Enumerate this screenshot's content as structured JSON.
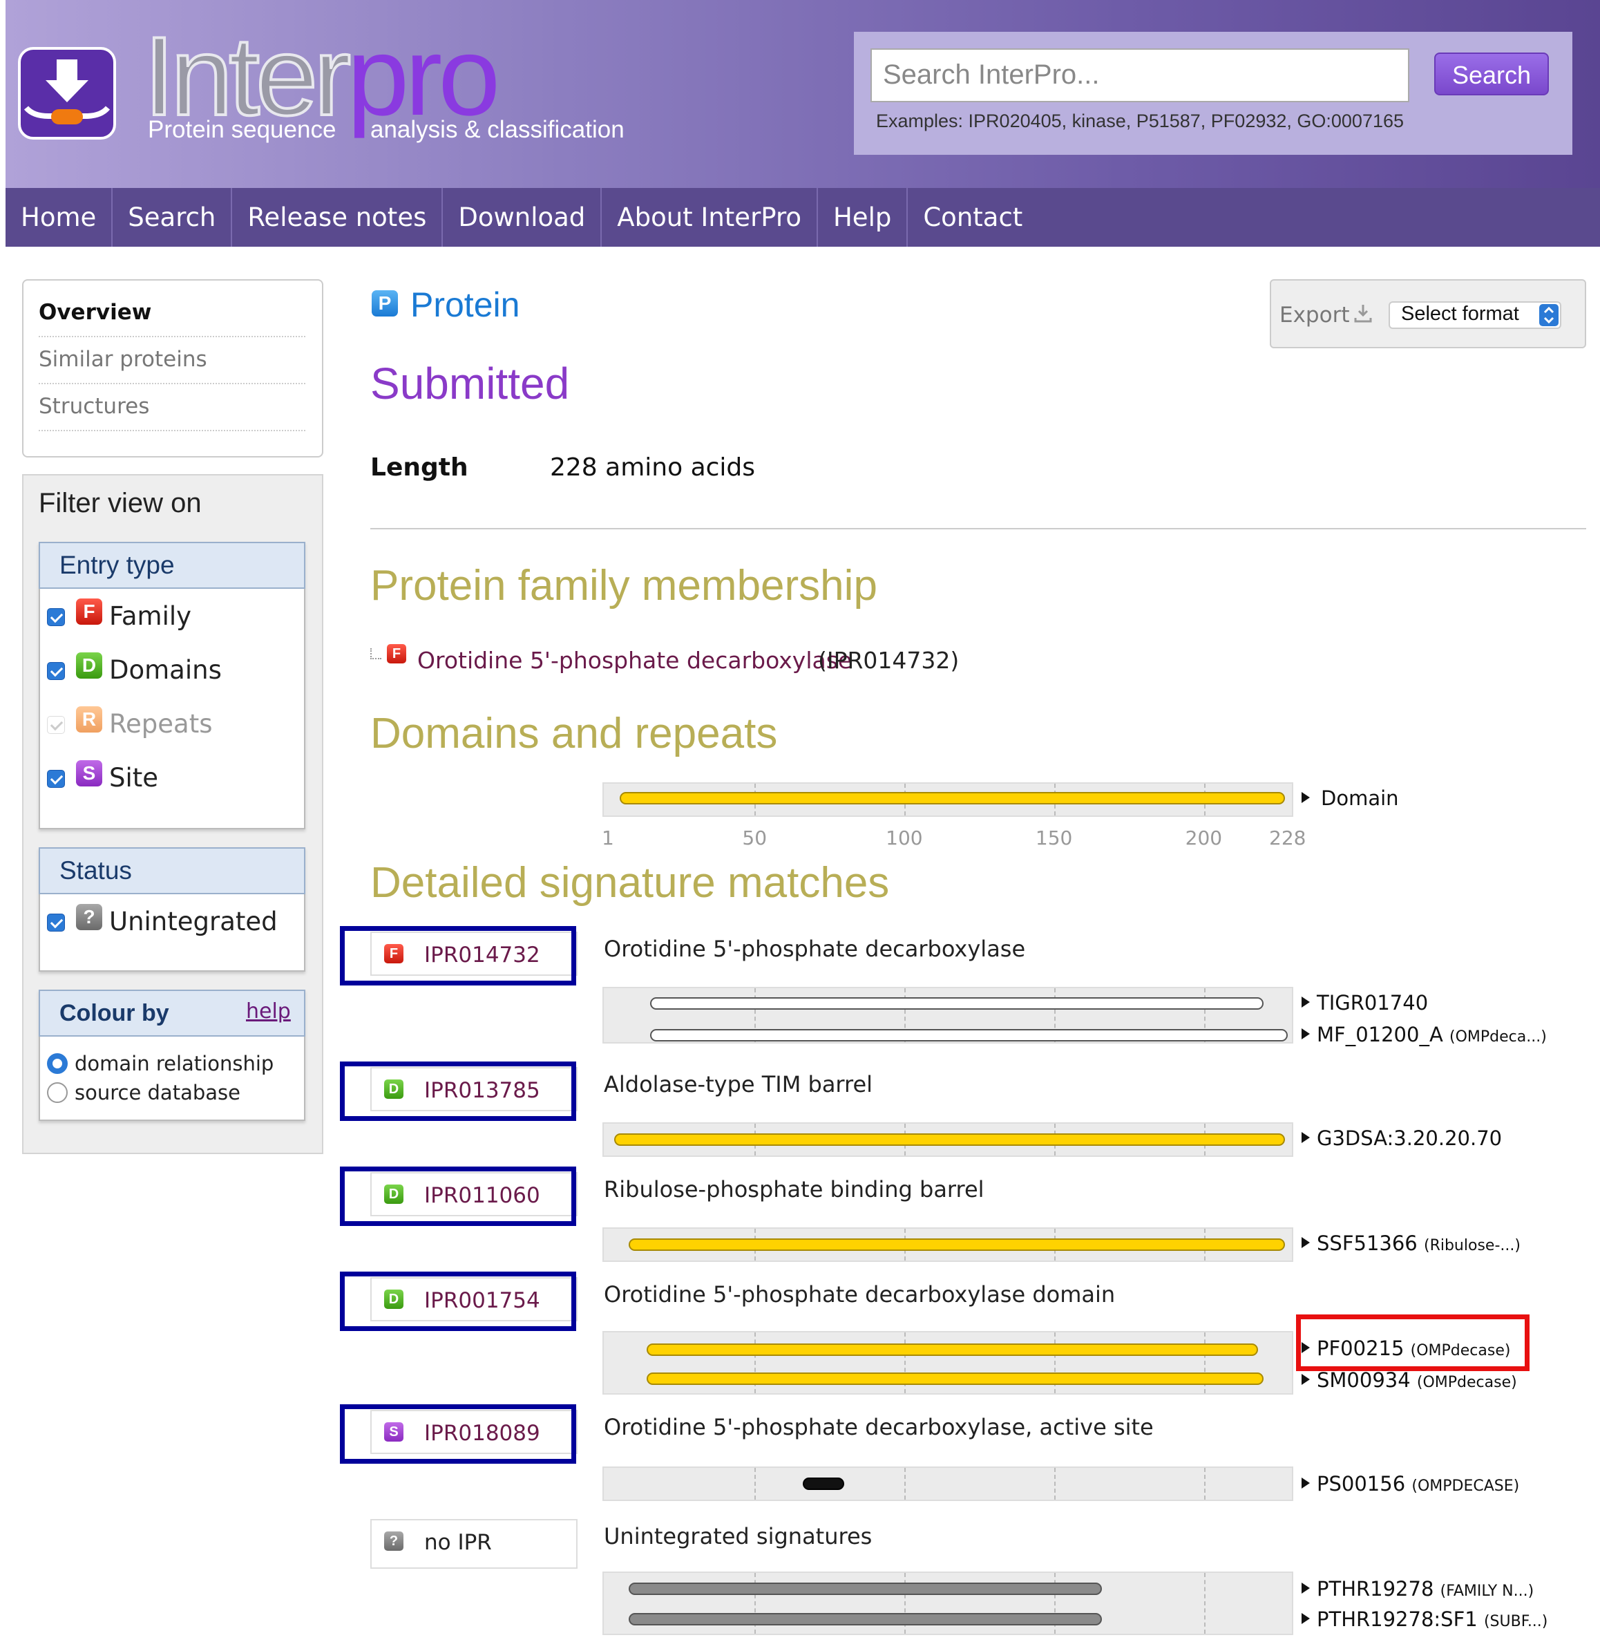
{
  "header": {
    "logo_inter": "Inter",
    "logo_pro": "pro",
    "tagline_left": "Protein sequence",
    "tagline_right": "analysis & classification",
    "search_placeholder": "Search InterPro...",
    "search_button": "Search",
    "examples": "Examples: IPR020405, kinase, P51587, PF02932, GO:0007165"
  },
  "nav": [
    "Home",
    "Search",
    "Release notes",
    "Download",
    "About InterPro",
    "Help",
    "Contact"
  ],
  "sidebar": {
    "links": [
      "Overview",
      "Similar proteins",
      "Structures"
    ],
    "filter_title": "Filter view on",
    "entry_type_title": "Entry type",
    "entry_types": [
      {
        "badge": "F",
        "label": "Family",
        "checked": true
      },
      {
        "badge": "D",
        "label": "Domains",
        "checked": true
      },
      {
        "badge": "R",
        "label": "Repeats",
        "checked": true,
        "disabled": true
      },
      {
        "badge": "S",
        "label": "Site",
        "checked": true
      }
    ],
    "status_title": "Status",
    "status_items": [
      {
        "badge": "?",
        "label": "Unintegrated",
        "checked": true
      }
    ],
    "colour_title": "Colour by",
    "colour_help": "help",
    "colour_options": [
      {
        "label": "domain relationship",
        "selected": true
      },
      {
        "label": "source database",
        "selected": false
      }
    ]
  },
  "main": {
    "protein_badge": "P",
    "protein_label": "Protein",
    "submitted": "Submitted",
    "length_label": "Length",
    "length_value": "228 amino acids",
    "export_label": "Export",
    "export_select": "Select format",
    "family_heading": "Protein family membership",
    "family_entry": {
      "badge": "F",
      "name": "Orotidine 5'-phosphate decarboxylase",
      "accession": "(IPR014732)"
    },
    "domains_heading": "Domains and repeats",
    "domain_label": "Domain",
    "axis_ticks": [
      "1",
      "50",
      "100",
      "150",
      "200",
      "228"
    ],
    "detail_heading": "Detailed signature matches",
    "matches": [
      {
        "badge": "F",
        "ipr": "IPR014732",
        "name": "Orotidine 5'-phosphate decarboxylase",
        "signatures": [
          {
            "id": "TIGR01740",
            "sub": "",
            "start": 15,
            "end": 220,
            "style": "w"
          },
          {
            "id": "MF_01200_A",
            "sub": "(OMPdeca...)",
            "start": 15,
            "end": 228,
            "style": "w"
          }
        ]
      },
      {
        "badge": "D",
        "ipr": "IPR013785",
        "name": "Aldolase-type TIM barrel",
        "signatures": [
          {
            "id": "G3DSA:3.20.20.70",
            "sub": "",
            "start": 3,
            "end": 227,
            "style": "y"
          }
        ]
      },
      {
        "badge": "D",
        "ipr": "IPR011060",
        "name": "Ribulose-phosphate binding barrel",
        "signatures": [
          {
            "id": "SSF51366",
            "sub": "(Ribulose-...)",
            "start": 8,
            "end": 227,
            "style": "y"
          }
        ]
      },
      {
        "badge": "D",
        "ipr": "IPR001754",
        "name": "Orotidine 5'-phosphate decarboxylase domain",
        "signatures": [
          {
            "id": "PF00215",
            "sub": "(OMPdecase)",
            "start": 14,
            "end": 218,
            "style": "y"
          },
          {
            "id": "SM00934",
            "sub": "(OMPdecase)",
            "start": 14,
            "end": 220,
            "style": "y"
          }
        ]
      },
      {
        "badge": "S",
        "ipr": "IPR018089",
        "name": "Orotidine 5'-phosphate decarboxylase, active site",
        "signatures": [
          {
            "id": "PS00156",
            "sub": "(OMPDECASE)",
            "start": 66,
            "end": 80,
            "style": "k"
          }
        ]
      },
      {
        "badge": "?",
        "ipr": "no IPR",
        "name": "Unintegrated signatures",
        "signatures": [
          {
            "id": "PTHR19278",
            "sub": "(FAMILY N...)",
            "start": 8,
            "end": 166,
            "style": "g"
          },
          {
            "id": "PTHR19278:SF1",
            "sub": "(SUBF...)",
            "start": 8,
            "end": 166,
            "style": "g"
          }
        ]
      }
    ]
  },
  "colors": {
    "accent": "#7a48cc",
    "nav": "#5a4a8e",
    "heading_gold": "#b8ae56",
    "domain_yellow": "#ffd200",
    "highlight_blue": "#00009a",
    "highlight_red": "#e81010"
  }
}
